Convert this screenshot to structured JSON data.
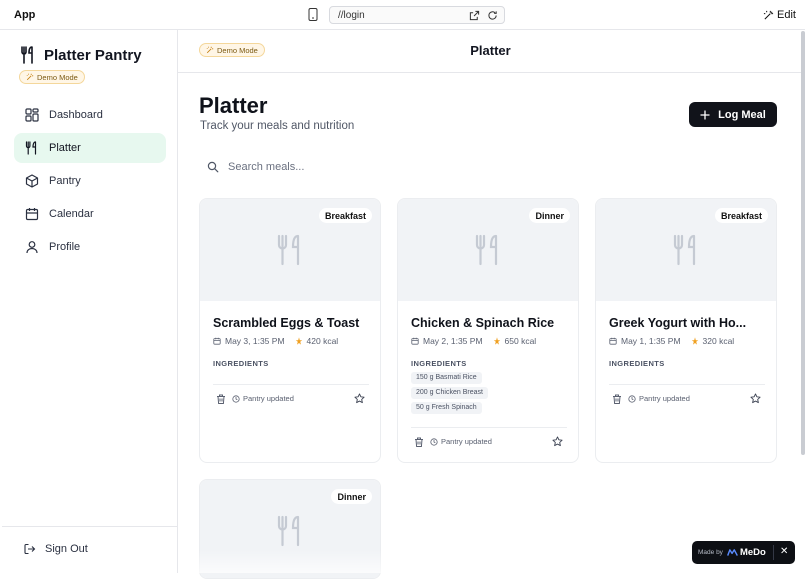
{
  "browser": {
    "app_label": "App",
    "url": "//login",
    "edit_label": "Edit"
  },
  "sidebar": {
    "brand": "Platter Pantry",
    "demo_badge": "Demo Mode",
    "items": [
      {
        "label": "Dashboard",
        "icon": "dashboard-icon",
        "active": false
      },
      {
        "label": "Platter",
        "icon": "utensils-icon",
        "active": true
      },
      {
        "label": "Pantry",
        "icon": "box-icon",
        "active": false
      },
      {
        "label": "Calendar",
        "icon": "calendar-icon",
        "active": false
      },
      {
        "label": "Profile",
        "icon": "user-icon",
        "active": false
      }
    ],
    "sign_out": "Sign Out"
  },
  "topbar": {
    "demo_badge": "Demo Mode",
    "title": "Platter"
  },
  "main": {
    "title": "Platter",
    "subtitle": "Track your meals and nutrition",
    "log_button": "Log Meal",
    "search_placeholder": "Search meals..."
  },
  "ingredients_label": "INGREDIENTS",
  "meals": [
    {
      "badge": "Breakfast",
      "title": "Scrambled Eggs & Toast",
      "date": "May 3, 1:35 PM",
      "kcal": "420 kcal",
      "ingredients": [],
      "status": "Pantry updated"
    },
    {
      "badge": "Dinner",
      "title": "Chicken & Spinach Rice",
      "date": "May 2, 1:35 PM",
      "kcal": "650 kcal",
      "ingredients": [
        "150 g Basmati Rice",
        "200 g Chicken Breast",
        "50 g Fresh Spinach"
      ],
      "status": "Pantry updated"
    },
    {
      "badge": "Breakfast",
      "title": "Greek Yogurt with Ho...",
      "date": "May 1, 1:35 PM",
      "kcal": "320 kcal",
      "ingredients": [],
      "status": "Pantry updated"
    },
    {
      "badge": "Dinner"
    }
  ],
  "medo": {
    "made_by": "Made by",
    "name": "MeDo",
    "close": "✕"
  },
  "colors": {
    "accent_active_bg": "#e7f8ef",
    "primary_button": "#11131a",
    "badge_bg": "#fff6e6",
    "kcal_icon": "#f0a020"
  }
}
